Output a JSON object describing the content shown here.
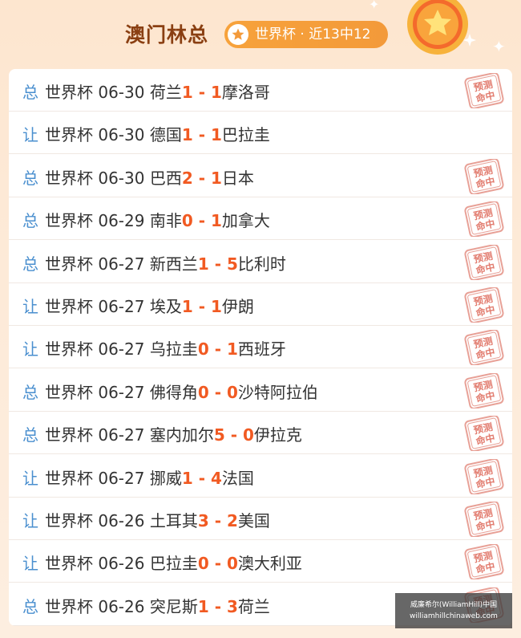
{
  "header": {
    "title": "澳门林总",
    "badge_text": "世界杯 · 近13中12"
  },
  "colors": {
    "accent": "#f15a22",
    "type_label": "#4a8fcf",
    "title": "#8a3f12"
  },
  "stamp_text": [
    "预测",
    "命中"
  ],
  "matches": [
    {
      "type": "总",
      "league": "世界杯",
      "date": "06-30",
      "home": "荷兰",
      "home_score": "1",
      "sep": " - ",
      "away_score": "1",
      "away": "摩洛哥",
      "hit": true
    },
    {
      "type": "让",
      "league": "世界杯",
      "date": "06-30",
      "home": "德国",
      "home_score": "1",
      "sep": " - ",
      "away_score": "1",
      "away": "巴拉圭",
      "hit": false
    },
    {
      "type": "总",
      "league": "世界杯",
      "date": "06-30",
      "home": "巴西",
      "home_score": "2",
      "sep": " - ",
      "away_score": "1",
      "away": "日本",
      "hit": true
    },
    {
      "type": "总",
      "league": "世界杯",
      "date": "06-29",
      "home": "南非",
      "home_score": "0",
      "sep": " - ",
      "away_score": "1",
      "away": "加拿大",
      "hit": true
    },
    {
      "type": "总",
      "league": "世界杯",
      "date": "06-27",
      "home": "新西兰",
      "home_score": "1",
      "sep": " - ",
      "away_score": "5",
      "away": "比利时",
      "hit": true
    },
    {
      "type": "让",
      "league": "世界杯",
      "date": "06-27",
      "home": "埃及",
      "home_score": "1",
      "sep": " - ",
      "away_score": "1",
      "away": "伊朗",
      "hit": true
    },
    {
      "type": "让",
      "league": "世界杯",
      "date": "06-27",
      "home": "乌拉圭",
      "home_score": "0",
      "sep": " - ",
      "away_score": "1",
      "away": "西班牙",
      "hit": true
    },
    {
      "type": "总",
      "league": "世界杯",
      "date": "06-27",
      "home": "佛得角",
      "home_score": "0",
      "sep": " - ",
      "away_score": "0",
      "away": "沙特阿拉伯",
      "hit": true
    },
    {
      "type": "总",
      "league": "世界杯",
      "date": "06-27",
      "home": "塞内加尔",
      "home_score": "5",
      "sep": " - ",
      "away_score": "0",
      "away": "伊拉克",
      "hit": true
    },
    {
      "type": "让",
      "league": "世界杯",
      "date": "06-27",
      "home": "挪威",
      "home_score": "1",
      "sep": " - ",
      "away_score": "4",
      "away": "法国",
      "hit": true
    },
    {
      "type": "让",
      "league": "世界杯",
      "date": "06-26",
      "home": "土耳其",
      "home_score": "3",
      "sep": " - ",
      "away_score": "2",
      "away": "美国",
      "hit": true
    },
    {
      "type": "让",
      "league": "世界杯",
      "date": "06-26",
      "home": "巴拉圭",
      "home_score": "0",
      "sep": " - ",
      "away_score": "0",
      "away": "澳大利亚",
      "hit": true
    },
    {
      "type": "总",
      "league": "世界杯",
      "date": "06-26",
      "home": "突尼斯",
      "home_score": "1",
      "sep": " - ",
      "away_score": "3",
      "away": "荷兰",
      "hit": true
    }
  ],
  "watermark": {
    "line1": "威廉希尔(WilliamHill)中国",
    "line2": "williamhillchinaweb.com"
  }
}
